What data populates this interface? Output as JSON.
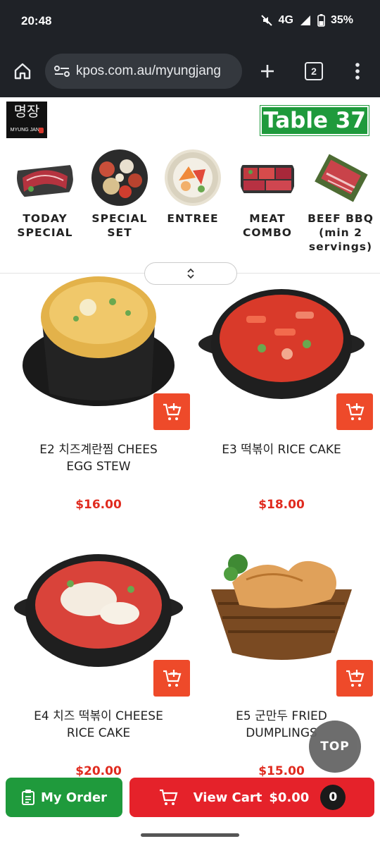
{
  "status": {
    "time": "20:48",
    "network": "4G",
    "battery": "35%"
  },
  "browser": {
    "url": "kpos.com.au/myungjang",
    "tab_count": "2"
  },
  "header": {
    "logo_korean": "명장",
    "logo_name": "MYUNG JANG",
    "table_label": "Table 37"
  },
  "categories": [
    {
      "line1": "TODAY",
      "line2": "SPECIAL",
      "line3": ""
    },
    {
      "line1": "SPECIAL",
      "line2": "SET",
      "line3": ""
    },
    {
      "line1": "ENTREE",
      "line2": "",
      "line3": ""
    },
    {
      "line1": "MEAT",
      "line2": "COMBO",
      "line3": ""
    },
    {
      "line1": "BEEF BBQ",
      "line2": "(min 2",
      "line3": "servings)"
    }
  ],
  "items": [
    {
      "name_line1": "E2 치즈계란찜 CHEES",
      "name_line2": "EGG STEW",
      "price": "$16.00"
    },
    {
      "name_line1": "E3 떡볶이 RICE CAKE",
      "name_line2": "",
      "price": "$18.00"
    },
    {
      "name_line1": "E4 치즈 떡볶이 CHEESE",
      "name_line2": "RICE CAKE",
      "price": "$20.00"
    },
    {
      "name_line1": "E5 군만두 FRIED",
      "name_line2": "DUMPLINGS",
      "price": "$15.00"
    }
  ],
  "top_button": "TOP",
  "bottom": {
    "my_order": "My Order",
    "view_cart": "View Cart",
    "cart_total": "$0.00",
    "cart_count": "0"
  },
  "colors": {
    "brand_green": "#1f9a3c",
    "cart_red": "#e5222a",
    "add_orange": "#ee4a2a",
    "price_red": "#e02b1f"
  }
}
